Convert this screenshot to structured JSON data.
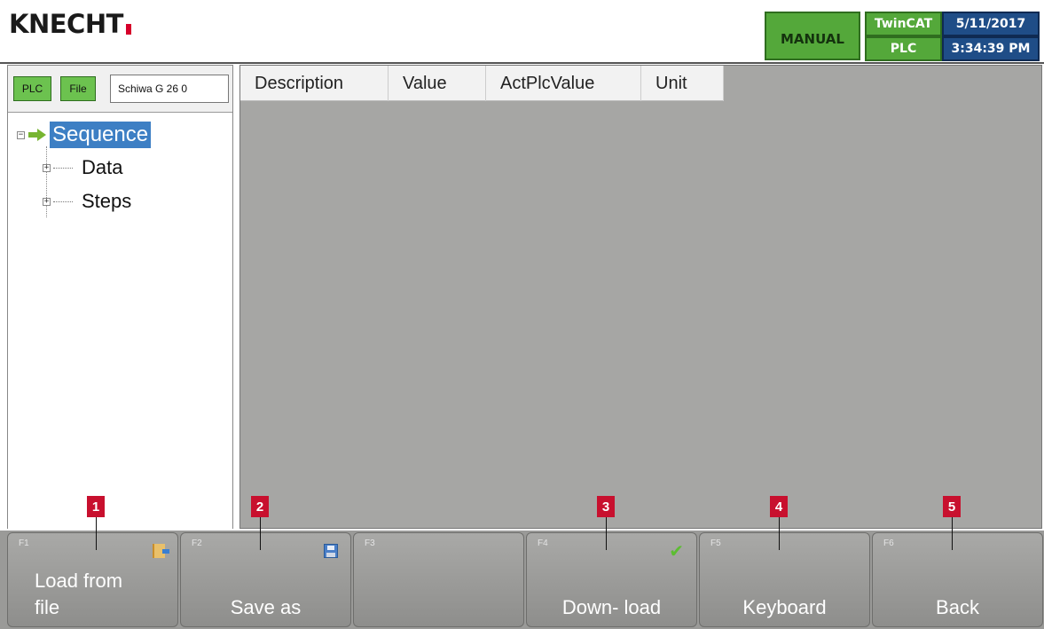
{
  "header": {
    "logo": "KNECHT",
    "mode": "MANUAL",
    "runtime": "TwinCAT",
    "controller": "PLC",
    "date": "5/11/2017",
    "time": "3:34:39 PM"
  },
  "source": {
    "plc_label": "PLC",
    "file_label": "File",
    "name": "Schiwa G 26 0"
  },
  "tree": {
    "root": "Sequence",
    "children": [
      "Data",
      "Steps"
    ]
  },
  "table": {
    "columns": [
      "Description",
      "Value",
      "ActPlcValue",
      "Unit"
    ]
  },
  "markers": [
    "1",
    "2",
    "3",
    "4",
    "5"
  ],
  "function_keys": [
    {
      "code": "F1",
      "label": "Load   from\nfile",
      "icon": "load-folder-icon"
    },
    {
      "code": "F2",
      "label": "Save as",
      "icon": "save-icon"
    },
    {
      "code": "F3",
      "label": "",
      "icon": ""
    },
    {
      "code": "F4",
      "label": "Down- load",
      "icon": "checkmark-icon"
    },
    {
      "code": "F5",
      "label": "Keyboard",
      "icon": ""
    },
    {
      "code": "F6",
      "label": "Back",
      "icon": ""
    }
  ],
  "colors": {
    "green": "#54a83a",
    "blue": "#1f4d87",
    "panel_gray": "#a6a6a4",
    "marker_red": "#c8102e",
    "selection_blue": "#3d7fc4"
  }
}
